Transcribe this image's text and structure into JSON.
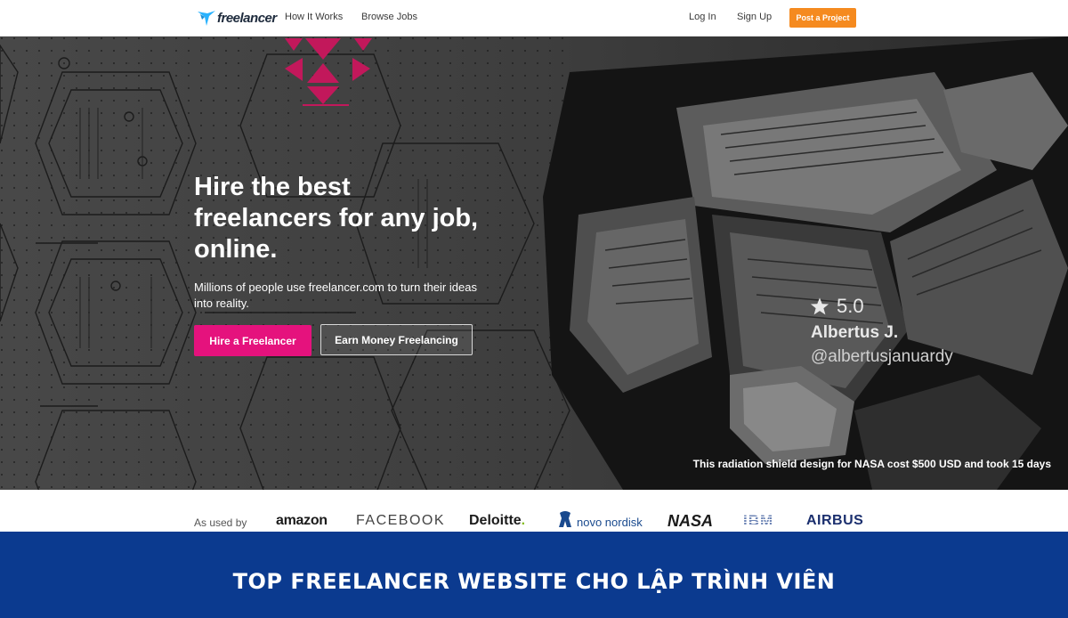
{
  "nav": {
    "logo_text": "freelancer",
    "links": [
      "How It Works",
      "Browse Jobs"
    ],
    "login": "Log In",
    "signup": "Sign Up",
    "post_project": "Post a Project"
  },
  "hero": {
    "title": "Hire the best\nfreelancers for any job,\nonline.",
    "subtitle": "Millions of people use freelancer.com to turn their ideas into reality.",
    "hire_button": "Hire a Freelancer",
    "earn_button": "Earn Money Freelancing",
    "rating": "5.0",
    "author_name": "Albertus J.",
    "author_handle": "@albertusjanuardy",
    "caption": "This radiation shield design for NASA cost $500 USD and took 15 days"
  },
  "logos": {
    "label": "As used by",
    "brands": [
      "amazon",
      "FACEBOOK",
      "Deloitte",
      "novo nordisk",
      "NASA",
      "IBM",
      "AIRBUS"
    ],
    "deloitte_dot": "."
  },
  "banner": {
    "text": "TOP FREELANCER WEBSITE CHO LẬP TRÌNH VIÊN"
  },
  "colors": {
    "accent_pink": "#e5127d",
    "accent_orange": "#f58a1f",
    "banner_blue": "#0b3a8f",
    "logo_blue": "#29b2fe"
  }
}
